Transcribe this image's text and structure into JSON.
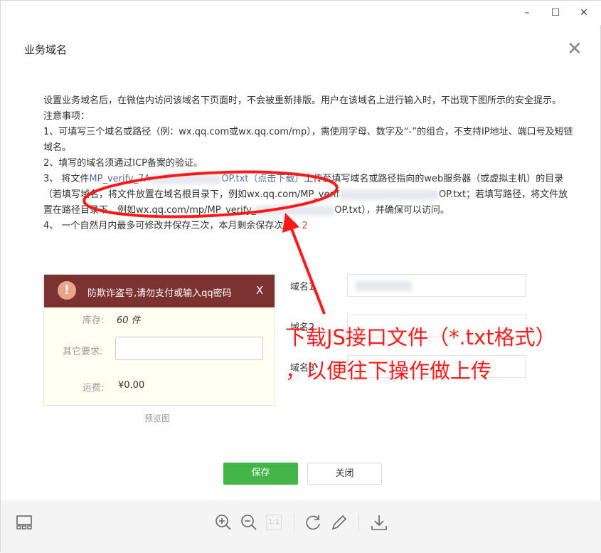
{
  "dialog": {
    "title": "业务域名"
  },
  "description": {
    "intro": "设置业务域名后，在微信内访问该域名下页面时，不会被重新排版。用户在该域名上进行输入时，不出现下图所示的安全提示。",
    "notes_title": "注意事项：",
    "note1": "1、可填写三个域名或路径（例：wx.qq.com或wx.qq.com/mp），需使用字母、数字及“-”的组合，不支持IP地址、端口号及短链域名。",
    "note2": "2、填写的域名须通过ICP备案的验证。",
    "note3_prefix": "3、 将文件",
    "note3_file_start": "MP_verify_7A",
    "note3_file_end": "OP.txt（点击下载）",
    "note3_mid": "上传至填写域名或路径指向的web服务器（或虚拟主机）的目录（若填写域名，将文件放置在域名根目录下，例如wx.qq.com/MP_verif",
    "note3_mid2": "OP.txt；若填写路径，将文件放置在路径目录下，例如wx.qq.com/mp/MP_verify_",
    "note3_end": "OP.txt），并确保可以访问。",
    "note4": "4、 一个自然月内最多可修改并保存三次，本月剩余保存次数：",
    "remaining": "2"
  },
  "preview": {
    "warning": "防欺诈盗号,请勿支付或输入qq密码",
    "warning_close": "X",
    "stock_label": "库存:",
    "stock_value": "60 件",
    "other_label": "其它要求:",
    "shipping_label": "运费:",
    "shipping_value": "¥0.00",
    "caption": "预览图"
  },
  "domains": [
    {
      "label": "域名1"
    },
    {
      "label": "域名2"
    },
    {
      "label": "域名3"
    }
  ],
  "buttons": {
    "save": "保存",
    "close": "关闭"
  },
  "annotation": {
    "line1": "下载JS接口文件（*.txt格式）",
    "line2": "，以便往下操作做上传"
  },
  "window": {
    "min": "–",
    "max": "☐",
    "close": "✕"
  },
  "viewer": {
    "actual_size": "1:1"
  },
  "colors": {
    "accent": "#44b549",
    "annotation": "#ff1a1a",
    "link": "#576b95",
    "warning_bg": "#7c3230"
  }
}
